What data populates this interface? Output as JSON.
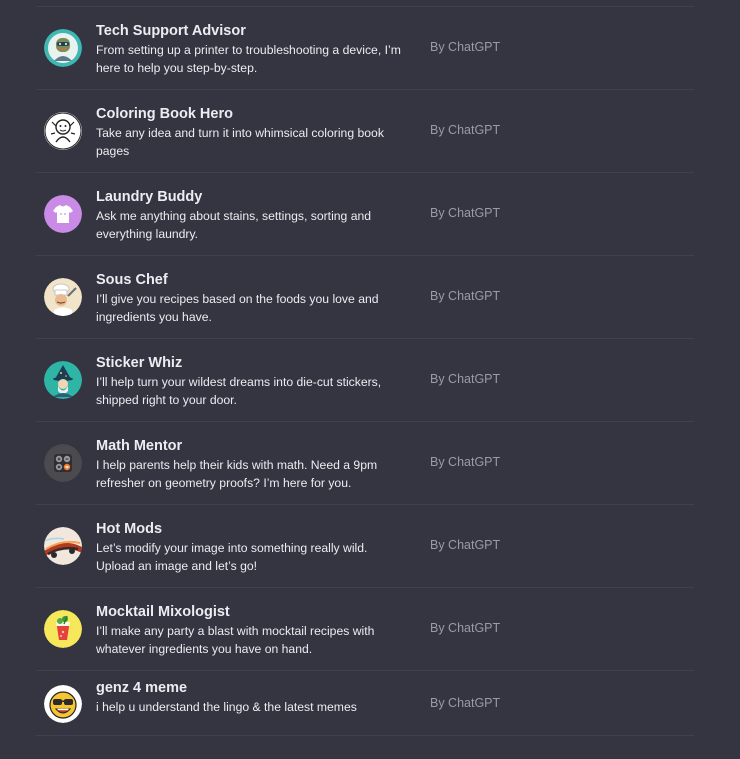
{
  "gpts": [
    {
      "name": "Tech Support Advisor",
      "description": "From setting up a printer to troubleshooting a device, I’m here to help you step-by-step.",
      "author": "By ChatGPT",
      "icon": "tech-support-robot-icon"
    },
    {
      "name": "Coloring Book Hero",
      "description": "Take any idea and turn it into whimsical coloring book pages",
      "author": "By ChatGPT",
      "icon": "coloring-book-line-art-icon"
    },
    {
      "name": "Laundry Buddy",
      "description": "Ask me anything about stains, settings, sorting and everything laundry.",
      "author": "By ChatGPT",
      "icon": "tshirt-icon"
    },
    {
      "name": "Sous Chef",
      "description": "I’ll give you recipes based on the foods you love and ingredients you have.",
      "author": "By ChatGPT",
      "icon": "chef-icon"
    },
    {
      "name": "Sticker Whiz",
      "description": "I’ll help turn your wildest dreams into die-cut stickers, shipped right to your door.",
      "author": "By ChatGPT",
      "icon": "wizard-sticker-icon"
    },
    {
      "name": "Math Mentor",
      "description": "I help parents help their kids with math. Need a 9pm refresher on geometry proofs? I’m here for you.",
      "author": "By ChatGPT",
      "icon": "calculator-icon"
    },
    {
      "name": "Hot Mods",
      "description": "Let’s modify your image into something really wild. Upload an image and let’s go!",
      "author": "By ChatGPT",
      "icon": "hot-rod-car-icon"
    },
    {
      "name": "Mocktail Mixologist",
      "description": "I’ll make any party a blast with mocktail recipes with whatever ingredients you have on hand.",
      "author": "By ChatGPT",
      "icon": "mocktail-glass-icon"
    },
    {
      "name": "genz 4 meme",
      "description": "i help u understand the lingo & the latest memes",
      "author": "By ChatGPT",
      "icon": "emoji-sunglasses-icon"
    }
  ],
  "colors": {
    "background": "#343541",
    "divider": "#40414f",
    "title": "#ececf1",
    "author": "#9b9ba6"
  }
}
